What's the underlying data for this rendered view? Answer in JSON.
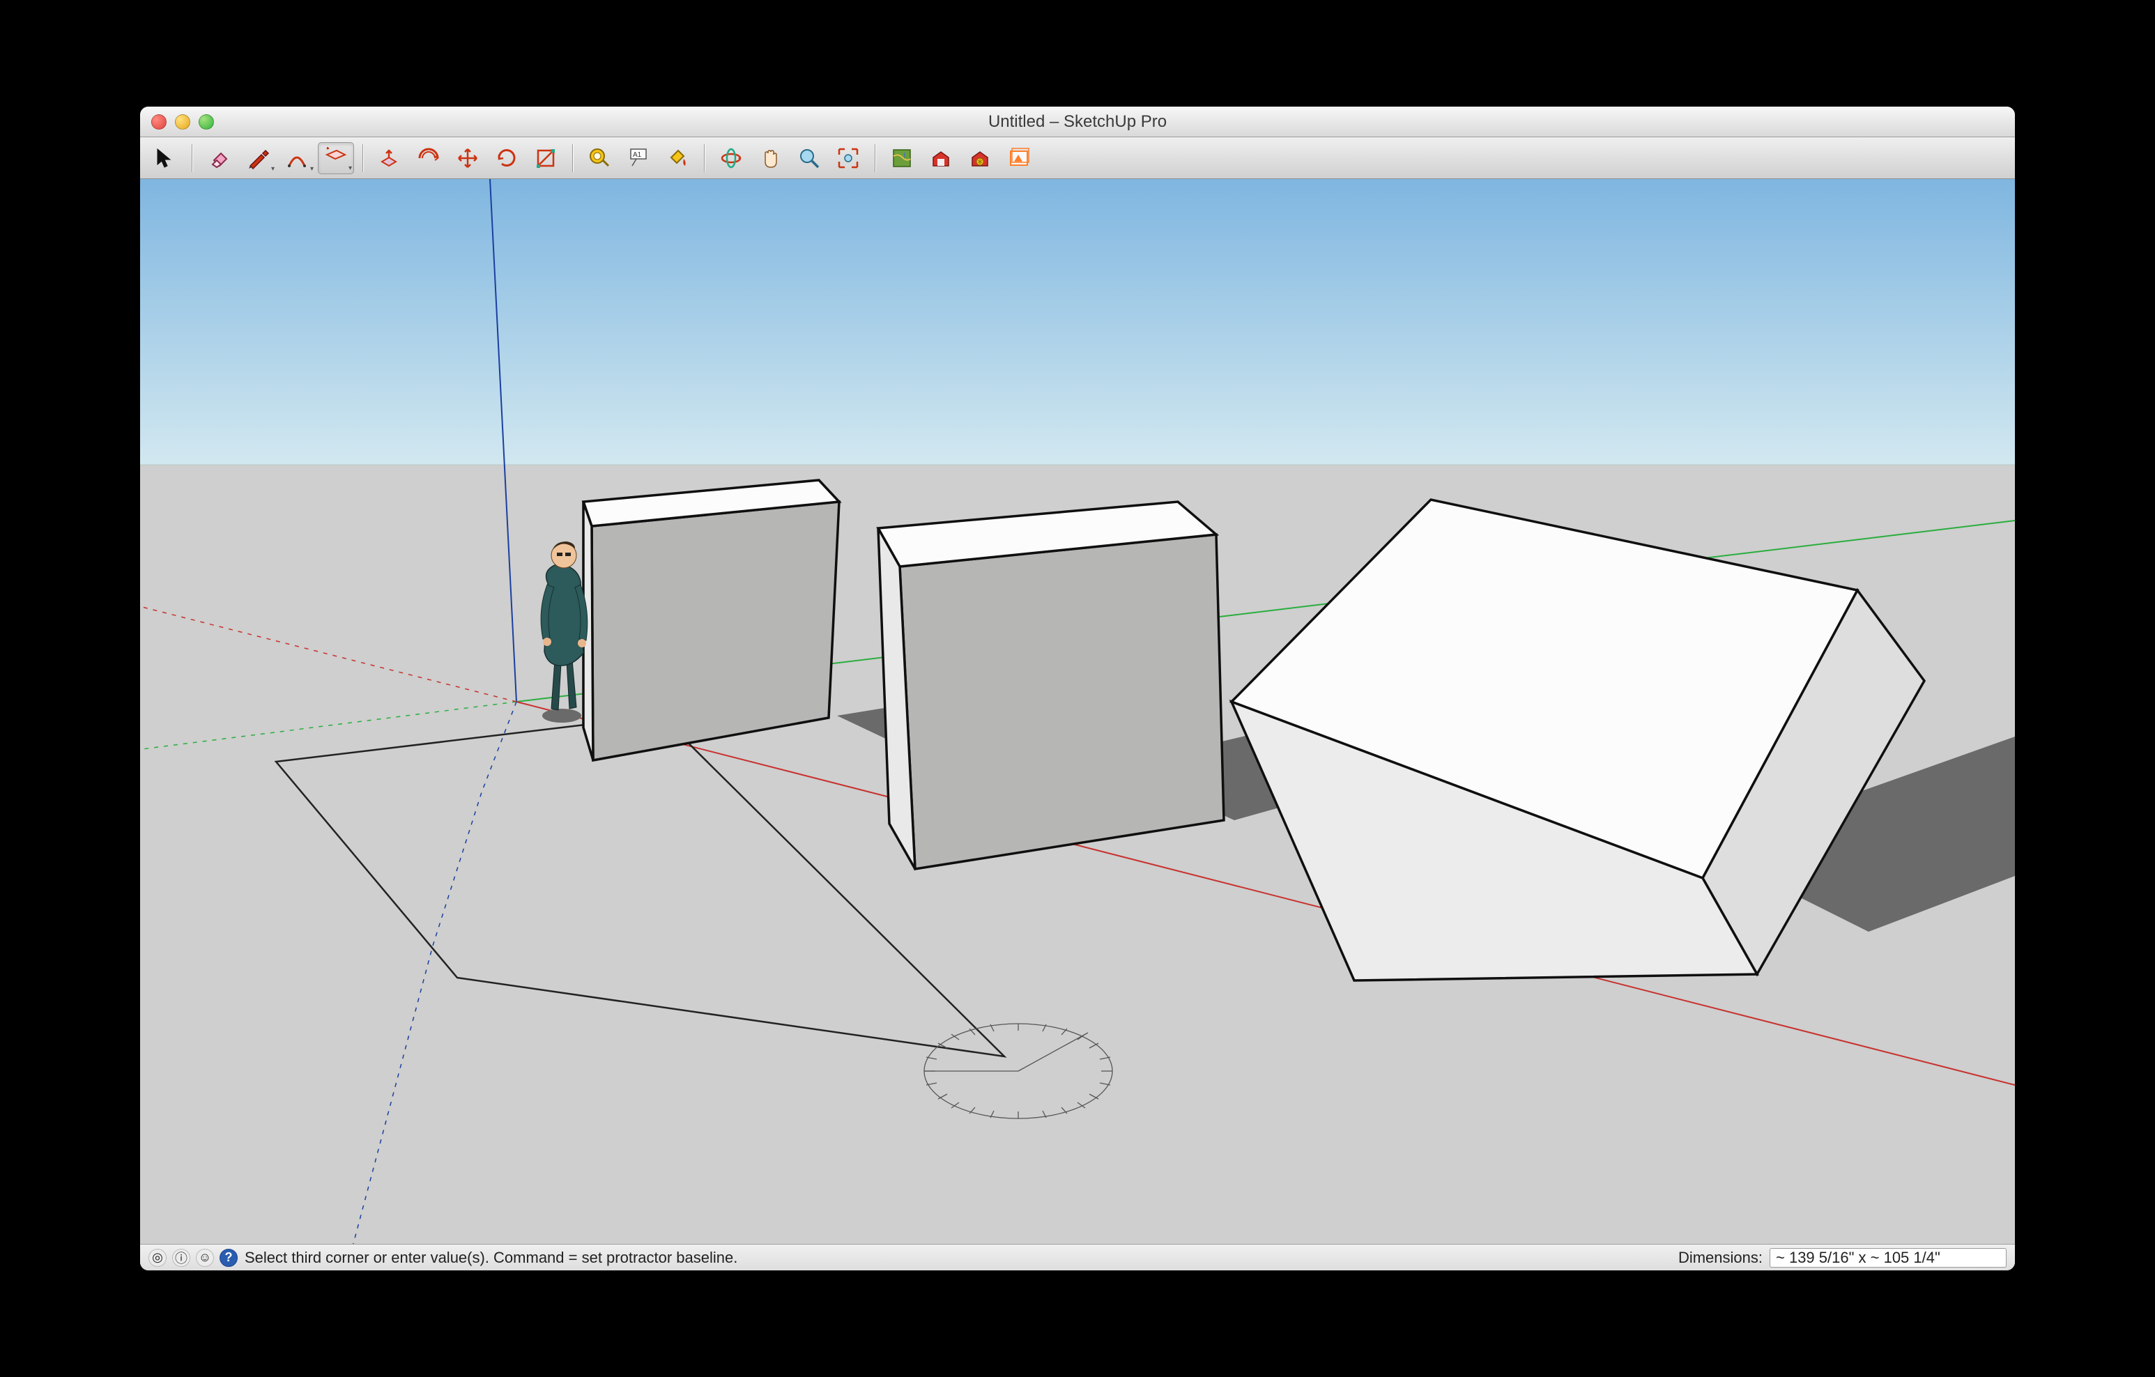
{
  "window": {
    "title": "Untitled – SketchUp Pro"
  },
  "toolbar": {
    "tools": [
      {
        "name": "select-tool",
        "icon": "cursor",
        "active": false,
        "dropdown": false
      },
      {
        "name": "eraser-tool",
        "icon": "eraser",
        "active": false,
        "dropdown": false
      },
      {
        "name": "line-tool",
        "icon": "pencil",
        "active": false,
        "dropdown": true
      },
      {
        "name": "arc-tool",
        "icon": "arc",
        "active": false,
        "dropdown": true
      },
      {
        "name": "rectangle-tool",
        "icon": "rectangle",
        "active": true,
        "dropdown": true
      },
      {
        "name": "push-pull-tool",
        "icon": "pushpull",
        "active": false,
        "dropdown": false
      },
      {
        "name": "offset-tool",
        "icon": "offset",
        "active": false,
        "dropdown": false
      },
      {
        "name": "move-tool",
        "icon": "move",
        "active": false,
        "dropdown": false
      },
      {
        "name": "rotate-tool",
        "icon": "rotate",
        "active": false,
        "dropdown": false
      },
      {
        "name": "scale-tool",
        "icon": "scale",
        "active": false,
        "dropdown": false
      },
      {
        "name": "tape-measure-tool",
        "icon": "tape",
        "active": false,
        "dropdown": false
      },
      {
        "name": "text-tool",
        "icon": "text",
        "active": false,
        "dropdown": false
      },
      {
        "name": "paint-bucket-tool",
        "icon": "bucket",
        "active": false,
        "dropdown": false
      },
      {
        "name": "orbit-tool",
        "icon": "orbit",
        "active": false,
        "dropdown": false
      },
      {
        "name": "pan-tool",
        "icon": "pan",
        "active": false,
        "dropdown": false
      },
      {
        "name": "zoom-tool",
        "icon": "zoom",
        "active": false,
        "dropdown": false
      },
      {
        "name": "zoom-extents-tool",
        "icon": "zoomextents",
        "active": false,
        "dropdown": false
      },
      {
        "name": "add-location-tool",
        "icon": "location",
        "active": false,
        "dropdown": false
      },
      {
        "name": "3d-warehouse-tool",
        "icon": "warehouse",
        "active": false,
        "dropdown": false
      },
      {
        "name": "extension-warehouse-tool",
        "icon": "extwarehouse",
        "active": false,
        "dropdown": false
      },
      {
        "name": "layout-tool",
        "icon": "layout",
        "active": false,
        "dropdown": false
      }
    ]
  },
  "status": {
    "hint": "Select third corner or enter value(s). Command = set protractor baseline.",
    "dim_label": "Dimensions:",
    "dim_value": "~ 139 5/16\" x ~ 105 1/4\""
  },
  "scene": {
    "sky_top": "#8eb9e0",
    "sky_bottom": "#d7e9f1",
    "ground": "#cecfce",
    "axes": {
      "red": "#c8312f",
      "green": "#2aad3e",
      "blue": "#1b3fa0"
    }
  }
}
